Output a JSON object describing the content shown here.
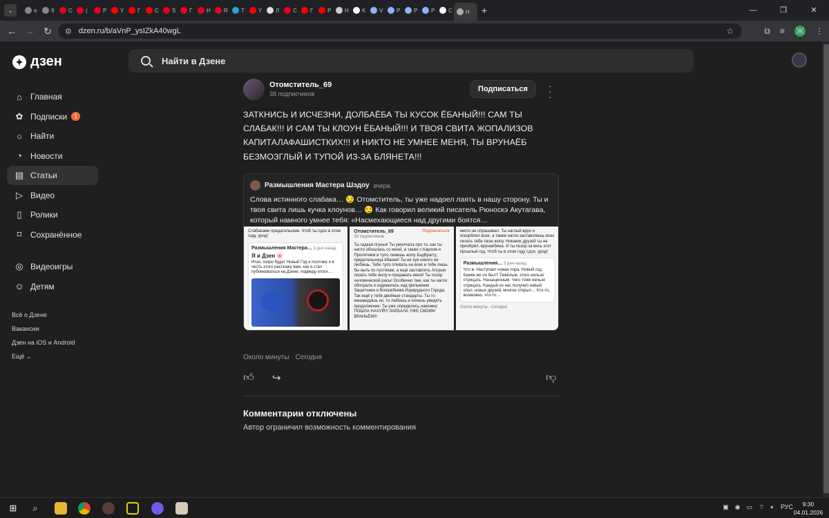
{
  "browser": {
    "tabs": [
      {
        "label": "e",
        "color": "#888888"
      },
      {
        "label": "9",
        "color": "#888888"
      },
      {
        "label": "C",
        "color": "#e60023"
      },
      {
        "label": "(",
        "color": "#e60023"
      },
      {
        "label": "P",
        "color": "#e60023"
      },
      {
        "label": "Y",
        "color": "#ff0000"
      },
      {
        "label": "Г",
        "color": "#ff0000"
      },
      {
        "label": "C",
        "color": "#ff0000"
      },
      {
        "label": "S",
        "color": "#e60023"
      },
      {
        "label": "Г",
        "color": "#e60023"
      },
      {
        "label": "H",
        "color": "#e60023"
      },
      {
        "label": "R",
        "color": "#e60023"
      },
      {
        "label": "T",
        "color": "#2aa3df"
      },
      {
        "label": "Y",
        "color": "#ff0000"
      },
      {
        "label": "Л",
        "color": "#dddddd"
      },
      {
        "label": "C",
        "color": "#e60023"
      },
      {
        "label": "Г",
        "color": "#ff0000"
      },
      {
        "label": "P",
        "color": "#ff0000"
      },
      {
        "label": "H",
        "color": "#cccccc"
      },
      {
        "label": "K",
        "color": "#ffffff"
      },
      {
        "label": "V",
        "color": "#8ab4f8"
      },
      {
        "label": "P",
        "color": "#8ab4f8"
      },
      {
        "label": "P",
        "color": "#8ab4f8"
      },
      {
        "label": "P",
        "color": "#8ab4f8"
      },
      {
        "label": "C",
        "color": "#ffffff"
      },
      {
        "label": "H",
        "color": "#aaaaaa"
      }
    ],
    "url": "dzen.ru/b/aVnP_ysIZkA40wgL",
    "new_tab": "+",
    "profile_initial": "Ж"
  },
  "header": {
    "logo_text": "дзен",
    "search_placeholder": "Найти в Дзене"
  },
  "sidebar": {
    "items": [
      {
        "label": "Главная",
        "icon": "home-icon",
        "glyph": "⌂"
      },
      {
        "label": "Подписки",
        "icon": "subscriptions-icon",
        "glyph": "✿",
        "badge": "1"
      },
      {
        "label": "Найти",
        "icon": "search-icon",
        "glyph": "○"
      },
      {
        "label": "Новости",
        "icon": "news-icon",
        "glyph": "◔"
      },
      {
        "label": "Статьи",
        "icon": "articles-icon",
        "glyph": "▤",
        "active": true
      },
      {
        "label": "Видео",
        "icon": "video-icon",
        "glyph": "▷"
      },
      {
        "label": "Ролики",
        "icon": "shorts-icon",
        "glyph": "▯"
      },
      {
        "label": "Сохранённое",
        "icon": "bookmark-icon",
        "glyph": "⌑"
      },
      {
        "label": "Видеоигры",
        "icon": "gamepad-icon",
        "glyph": "◎"
      },
      {
        "label": "Детям",
        "icon": "kids-icon",
        "glyph": "☺"
      }
    ],
    "links": [
      "Всё о Дзене",
      "Вакансии",
      "Дзен на iOS и Android",
      "Ещё"
    ]
  },
  "post": {
    "author_name": "Отомститель_69",
    "author_subscribers": "38 подписчиков",
    "subscribe_label": "Подписаться",
    "text": "ЗАТКНИСЬ И ИСЧЕЗНИ, ДОЛБАЁБА ТЫ КУСОК ЁБАНЫЙ!!! САМ ТЫ СЛАБАК!!! И САМ ТЫ КЛОУН ЁБАНЫЙ!!! И ТВОЯ СВИТА ЖОПАЛИЗОВ КАПИТАЛАФАШИСТКИХ!!! И НИКТО НЕ УМНЕЕ МЕНЯ, ТЫ ВРУНАЁБ БЕЗМОЗГЛЫЙ И ТУПОЙ ИЗ-ЗА БЛЯНЕТА!!!",
    "quote": {
      "author": "Размышления Мастера Шэдоу",
      "time": "вчера",
      "text": "Слова истинного слабака… 😏 Отомститель, ты уже надоел лаять в нашу сторону. Ты и твоя свита лишь кучка клоунов… 😏 Как говорил великий писатель Рюноскэ Акутагава, который намного умнее тебя: «Насмехающиеся над другими боятся…",
      "thumbs": [
        {
          "top": "Слабаками предательские. Чтоб ты сдох в этом году, урод!",
          "card_author": "Размышления Мастера…",
          "card_time": "3 дня назад",
          "card_title": "Я и Дзен 🌸",
          "card_text": "Итак, скоро будет Новый Год и поэтому я в честь этого расскажу вам, как я стал публиковаться на Дзене, подведу итоги…"
        },
        {
          "card_author": "Отомститель_69",
          "card_subs": "38 подписчиков",
          "card_subscribe": "Подписаться",
          "card_text": "Ты гадкая лгунья! Ты умолчала про то, как ты нагло обошлась со мной, а также с Карлом и Пролятием и тупо лижешь жопу БэдВраггу, предательница ёбаная! Ты не хуя никого не любишь. Тебе тупо плевать на всех и тебе лишь бы ныть по пустякам, а ещё заставлять Атсуши лизать тебе жопу и предавать меня! Ты позор человеческой расы! Особенно тем, как ты нагло обосрала и издевалась над фильмами Защитники и Волшебника Изумрудного Города. Так ещё у тебя двойные стандарты. Ты то ненавидишь их, то любишь и хочешь увидеть продолжение. Ты уже определись наконец! ПОШЛА НАХУЙ!!! ЗАЕБАЛА УЖЕ СВОИМ ВРАНЬЁМ!!!"
        },
        {
          "top": "никто не спрашивал. Ты наглый врун и оскорблял всех, а также нагло заставляешь всех лизать тебе твою жопу. Никаких друзей ты не приобрёл, врунаёбина. И ты позор за весь этот прошлый год. Чтоб ты в этом году сдох, урод!",
          "card_author": "Размышления…",
          "card_time": "3 дня назад",
          "card_text": "Что ж. Наступает новая пора. Новый год. Каким же он был? Тяжёлым, этого нельзя отрицать. Насыщенным. Чего тоже нельзя отрицать. Каждый из нас получил новый опыт, новых друзей, многое открыл… Кто-то, возможно, что-то…",
          "footer": "Около минуты · Сегодня"
        }
      ]
    },
    "meta": "Около минуты · Сегодня",
    "comments_title": "Комментарии отключены",
    "comments_note": "Автор ограничил возможность комментирования"
  },
  "taskbar": {
    "language": "РУС",
    "time": "9:30",
    "date": "04.01.2026"
  }
}
